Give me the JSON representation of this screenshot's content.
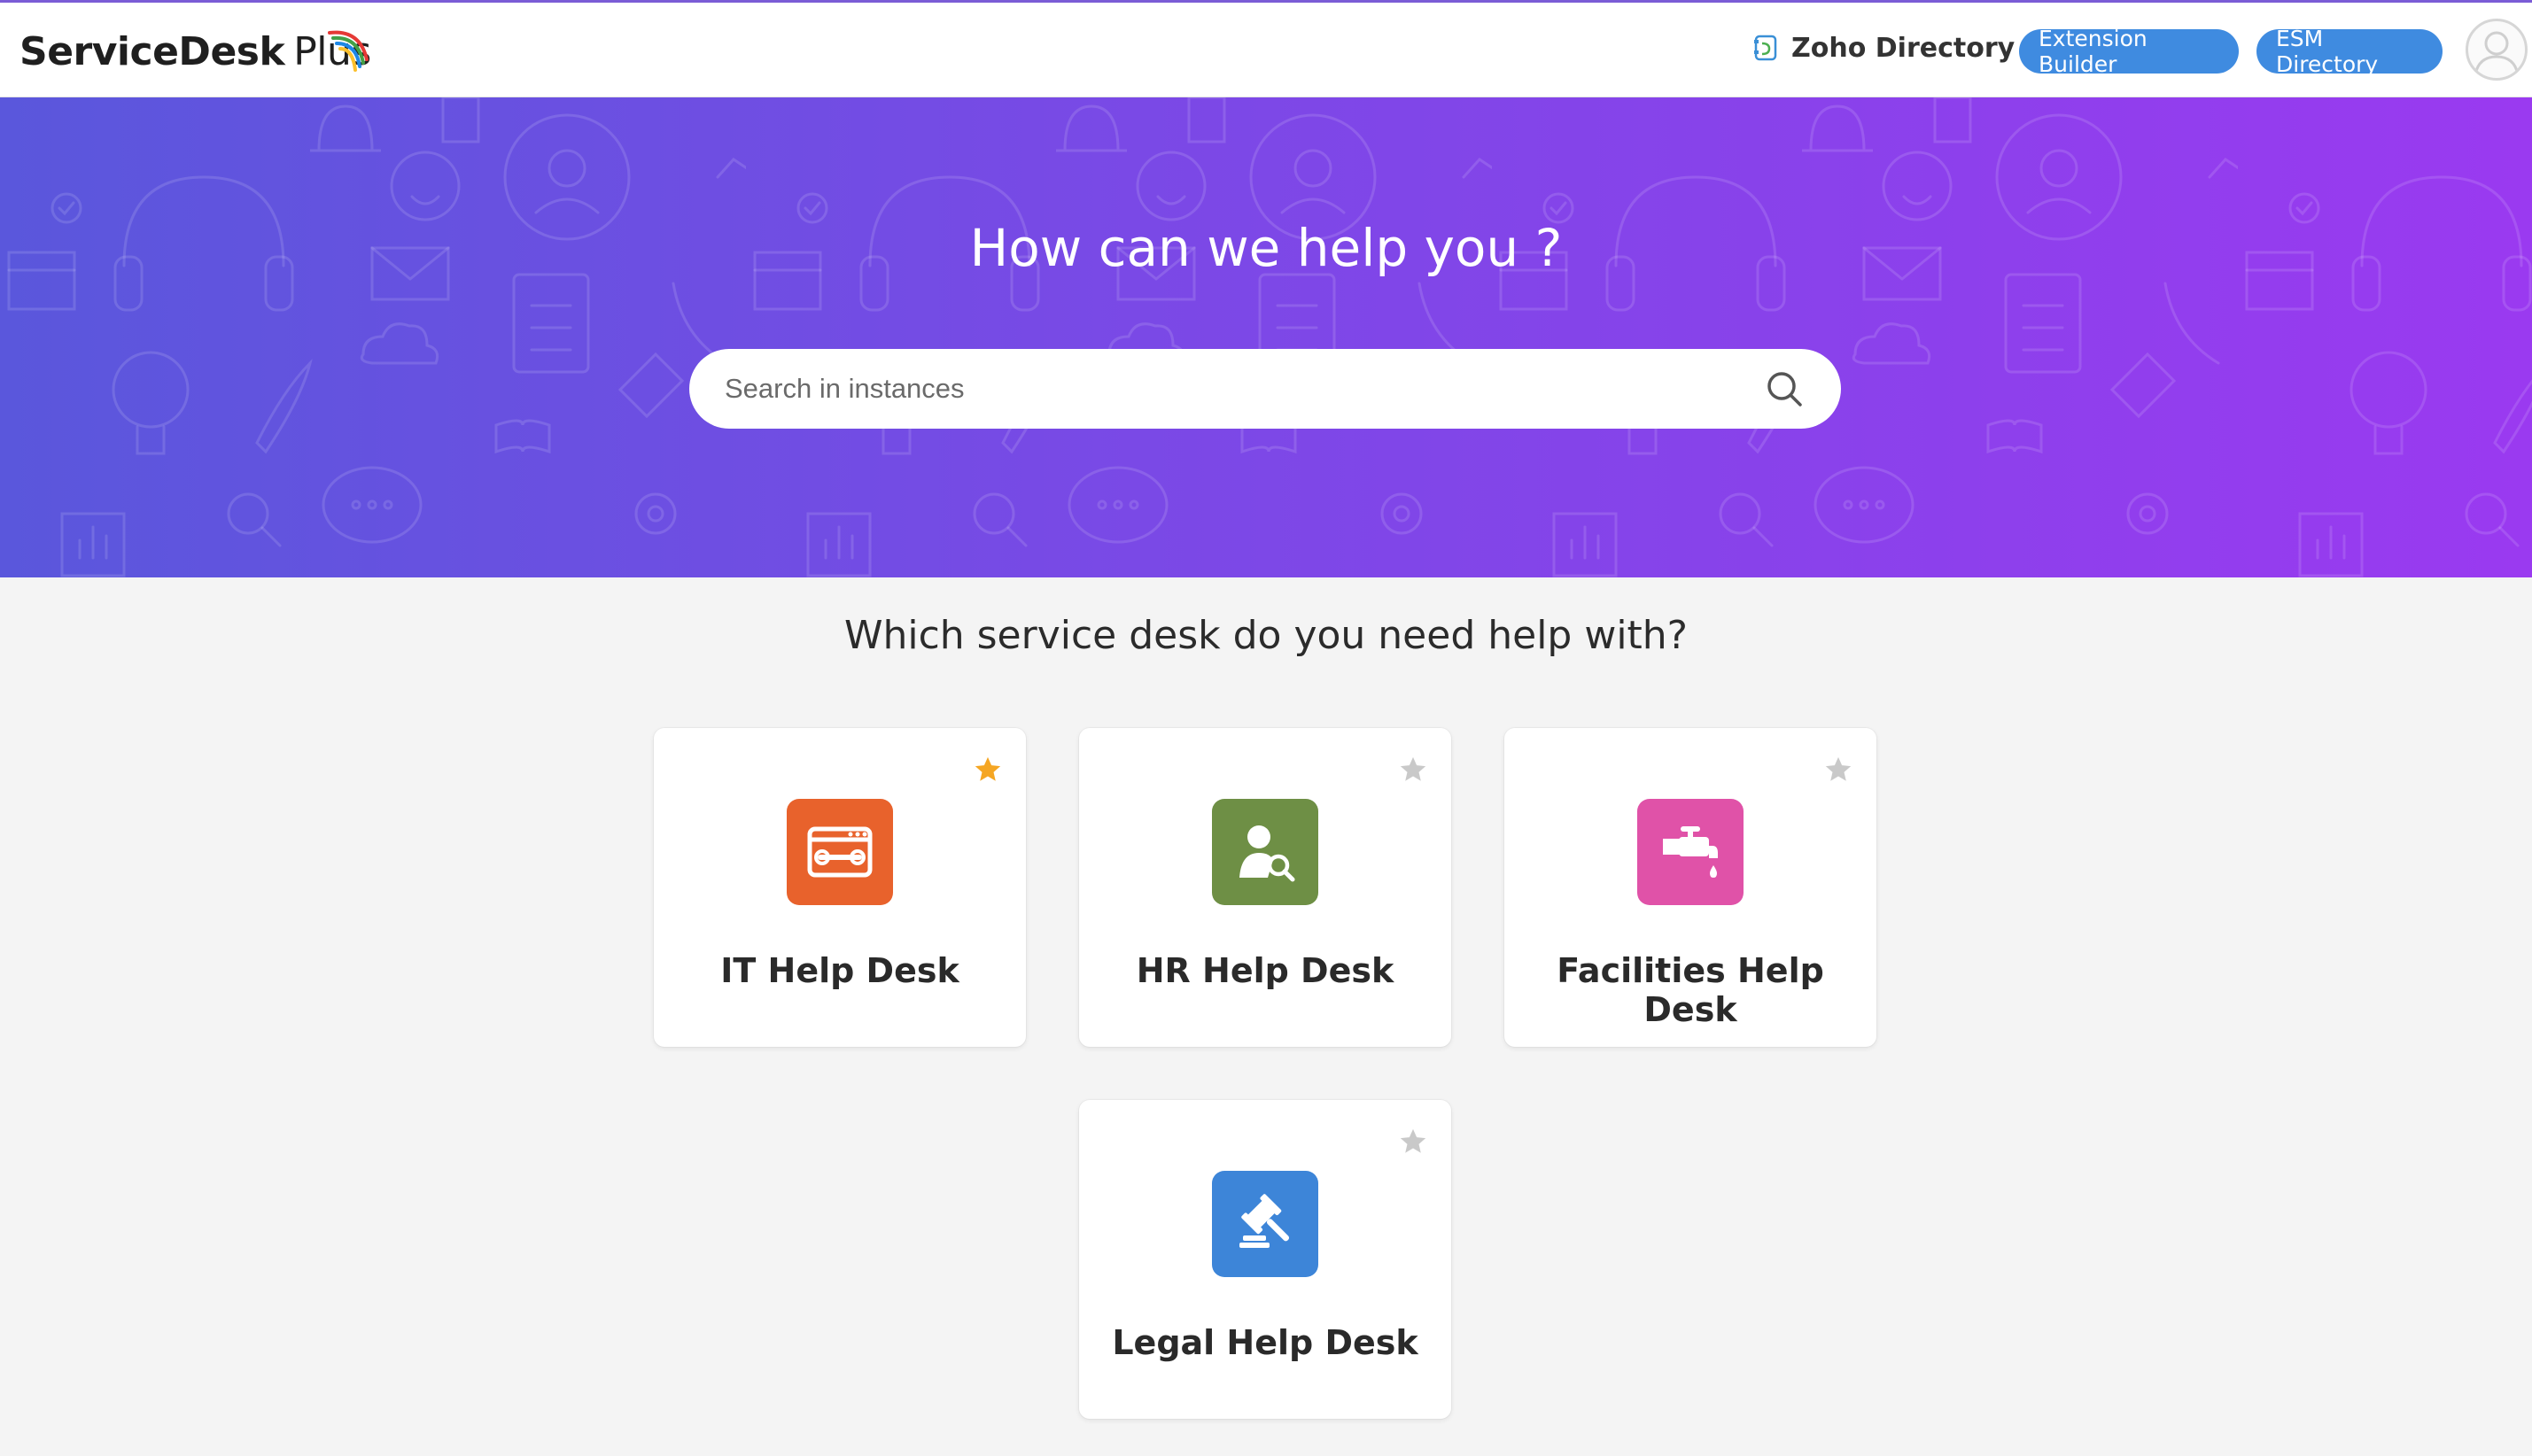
{
  "header": {
    "brand": {
      "name_bold": "ServiceDesk",
      "name_rest": "Plus"
    },
    "zoho_directory": {
      "label": "Zoho Directory",
      "icon": "zoho-directory-icon"
    },
    "extension_builder": {
      "label": "Extension Builder"
    },
    "esm_directory": {
      "label": "ESM Directory"
    },
    "avatar": {
      "icon": "user-avatar-icon"
    },
    "accent_color": "#7b5cd6",
    "button_color": "#3f8be0"
  },
  "hero": {
    "title": "How can we help you ?",
    "search": {
      "placeholder": "Search in instances",
      "icon": "search-icon"
    },
    "gradient": [
      "#5a57dc",
      "#9a3af0"
    ]
  },
  "main": {
    "question": "Which service desk do you need help with?",
    "desks": [
      {
        "label": "IT Help Desk",
        "favorite": true,
        "icon": "tools-icon",
        "color": "#e8622c"
      },
      {
        "label": "HR Help Desk",
        "favorite": false,
        "icon": "person-search-icon",
        "color": "#6e8f45"
      },
      {
        "label": "Facilities Help Desk",
        "favorite": false,
        "icon": "faucet-icon",
        "color": "#e052a8"
      },
      {
        "label": "Legal Help Desk",
        "favorite": false,
        "icon": "gavel-icon",
        "color": "#3d85d8"
      }
    ],
    "star_colors": {
      "on": "#f5a623",
      "off": "#c9c9c9"
    }
  }
}
